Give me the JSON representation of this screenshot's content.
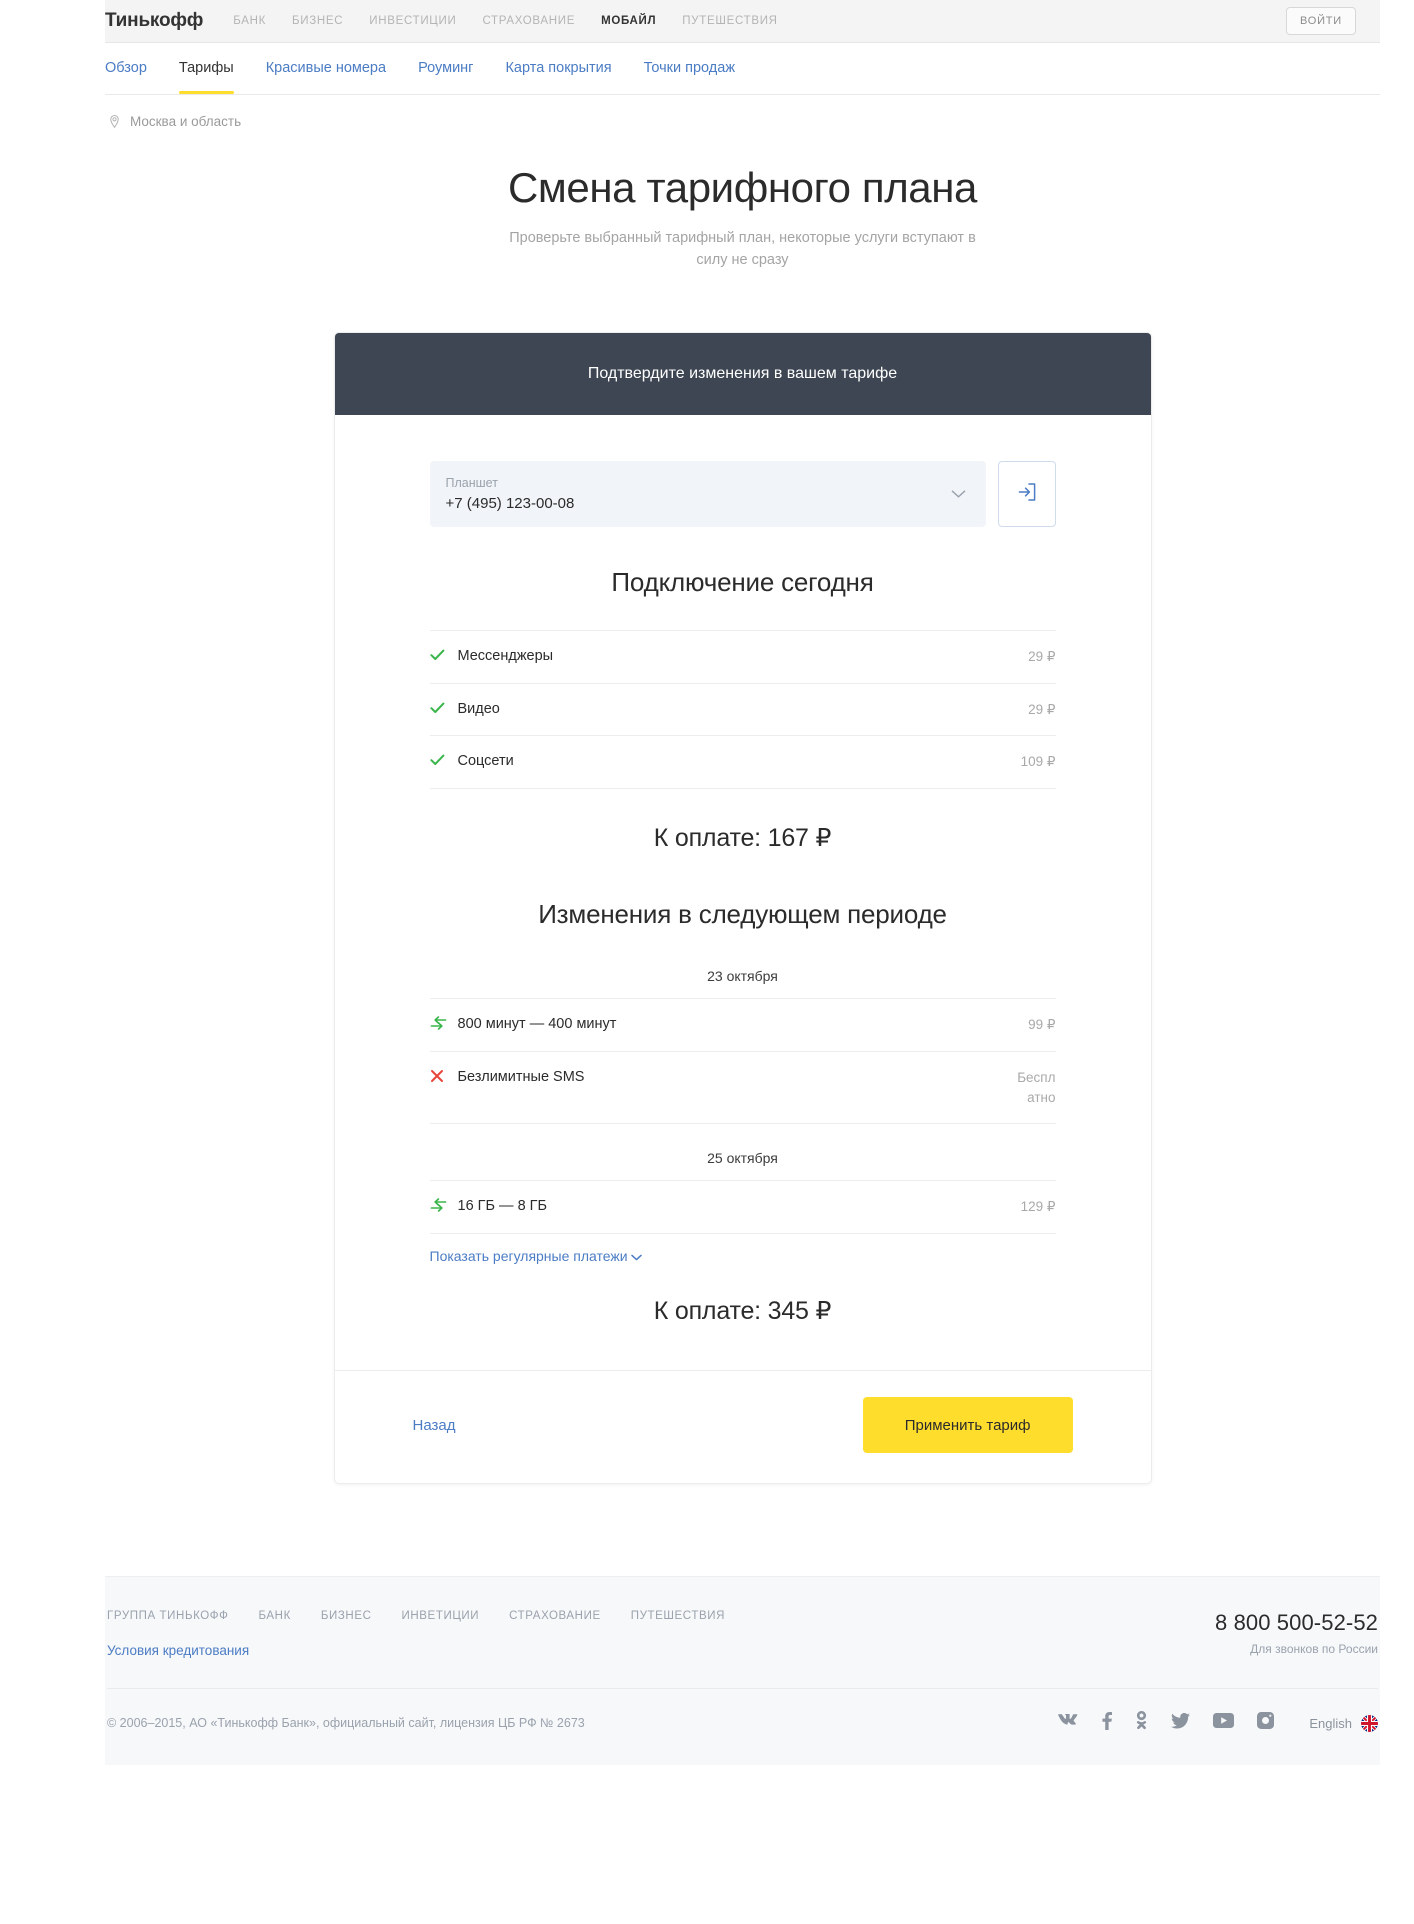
{
  "header": {
    "brand": "Тинькофф",
    "nav": [
      {
        "label": "БАНК",
        "active": false
      },
      {
        "label": "БИЗНЕС",
        "active": false
      },
      {
        "label": "ИНВЕСТИЦИИ",
        "active": false
      },
      {
        "label": "СТРАХОВАНИЕ",
        "active": false
      },
      {
        "label": "МОБАЙЛ",
        "active": true
      },
      {
        "label": "ПУТЕШЕСТВИЯ",
        "active": false
      }
    ],
    "login_label": "ВОЙТИ"
  },
  "subnav": {
    "items": [
      {
        "label": "Обзор",
        "active": false
      },
      {
        "label": "Тарифы",
        "active": true
      },
      {
        "label": "Красивые номера",
        "active": false
      },
      {
        "label": "Роуминг",
        "active": false
      },
      {
        "label": "Карта покрытия",
        "active": false
      },
      {
        "label": "Точки продаж",
        "active": false
      }
    ]
  },
  "location": {
    "icon": "map-pin-icon",
    "label": "Москва и область"
  },
  "hero": {
    "title": "Смена тарифного плана",
    "subtitle": "Проверьте выбранный тарифный план, некоторые услуги вступают в силу не сразу"
  },
  "card": {
    "header_title": "Подтвердите изменения в вашем тарифе",
    "phone": {
      "label": "Планшет",
      "value": "+7 (495) 123-00-08",
      "chevron_icon": "chevron-down-icon",
      "go_icon": "login-arrow-icon"
    },
    "today": {
      "title": "Подключение сегодня",
      "items": [
        {
          "icon": "check-icon",
          "name": "Мессенджеры",
          "price": "29 ₽"
        },
        {
          "icon": "check-icon",
          "name": "Видео",
          "price": "29 ₽"
        },
        {
          "icon": "check-icon",
          "name": "Соцсети",
          "price": "109 ₽"
        }
      ],
      "total": "К оплате: 167 ₽"
    },
    "next_period": {
      "title": "Изменения в следующем периоде",
      "groups": [
        {
          "date": "23 октября",
          "items": [
            {
              "icon": "exchange-icon",
              "name": "800 минут — 400 минут",
              "price": "99 ₽"
            },
            {
              "icon": "cross-icon",
              "name": "Безлимитные SMS",
              "price": "Бесплатно"
            }
          ]
        },
        {
          "date": "25 октября",
          "items": [
            {
              "icon": "exchange-icon",
              "name": "16 ГБ — 8 ГБ",
              "price": "129 ₽"
            }
          ]
        }
      ],
      "show_regular_label": "Показать регулярные платежи",
      "show_regular_icon": "chevron-down-icon",
      "total": "К оплате: 345 ₽"
    },
    "footer": {
      "back_label": "Назад",
      "apply_label": "Применить тариф"
    }
  },
  "footer": {
    "links": [
      {
        "label": "ГРУППА ТИНЬКОФФ"
      },
      {
        "label": "БАНК"
      },
      {
        "label": "БИЗНЕС"
      },
      {
        "label": "ИНВЕТИЦИИ"
      },
      {
        "label": "СТРАХОВАНИЕ"
      },
      {
        "label": "ПУТЕШЕСТВИЯ"
      }
    ],
    "terms_label": "Условия кредитования",
    "phone": "8 800 500-52-52",
    "phone_note": "Для звонков по России",
    "copyright": "© 2006–2015, АО «Тинькофф Банк», официальный сайт, лицензия ЦБ РФ № 2673",
    "socials": [
      {
        "icon": "vk-icon"
      },
      {
        "icon": "facebook-icon"
      },
      {
        "icon": "odnoklassniki-icon"
      },
      {
        "icon": "twitter-icon"
      },
      {
        "icon": "youtube-icon"
      },
      {
        "icon": "instagram-icon"
      }
    ],
    "language_label": "English",
    "language_flag_icon": "uk-flag-icon"
  },
  "colors": {
    "accent_yellow": "#ffdd2d",
    "link_blue": "#4b7cc4",
    "card_header": "#3d4652",
    "green": "#39b54a",
    "red": "#e8453c"
  }
}
